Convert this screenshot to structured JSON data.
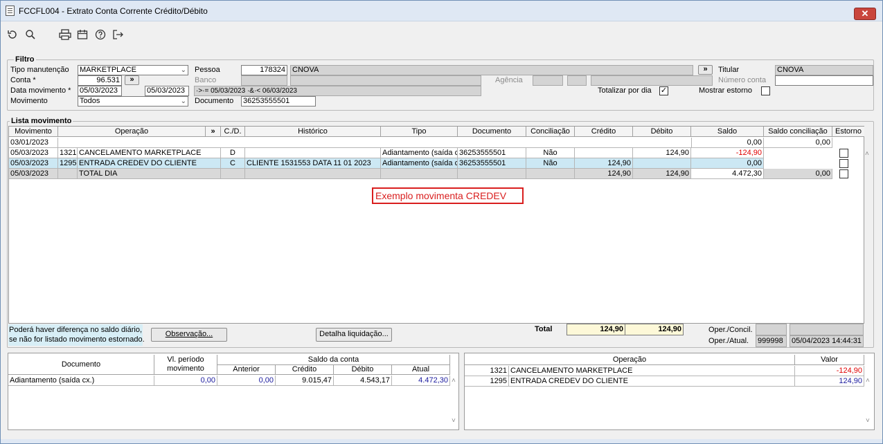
{
  "window": {
    "title": "FCCFL004 - Extrato Conta Corrente Crédito/Débito",
    "close_label": "✕"
  },
  "toolbar": {
    "icons": [
      "refresh-icon",
      "search-icon",
      "print-icon",
      "calendar-icon",
      "help-icon",
      "exit-icon"
    ]
  },
  "filtro": {
    "title": "Filtro",
    "tipo_manutencao_label": "Tipo manutenção",
    "tipo_manutencao_value": "MARKETPLACE",
    "conta_label": "Conta *",
    "conta_value": "96.531",
    "data_movimento_label": "Data movimento *",
    "data_de": "05/03/2023",
    "data_ate": "05/03/2023",
    "data_expr": "·>·= 05/03/2023 ·&·< 06/03/2023",
    "movimento_label": "Movimento",
    "movimento_value": "Todos",
    "pessoa_label": "Pessoa",
    "pessoa_code": "178324",
    "pessoa_name": "CNOVA",
    "banco_label": "Banco",
    "agencia_label": "Agência",
    "documento_label": "Documento",
    "documento_value": "36253555501",
    "titular_label": "Titular",
    "titular_value": "CNOVA",
    "numero_conta_label": "Número conta",
    "totalizar_label": "Totalizar por dia",
    "totalizar_checked": "✓",
    "mostrar_estorno_label": "Mostrar estorno",
    "lookup_label": "»"
  },
  "lista": {
    "title": "Lista movimento",
    "headers": [
      "Movimento",
      "Operação",
      "»",
      "C./D.",
      "Histórico",
      "Tipo",
      "Documento",
      "Conciliação",
      "Crédito",
      "Débito",
      "Saldo",
      "Saldo conciliação",
      "Estorno"
    ],
    "rows": [
      {
        "mov": "03/01/2023",
        "cod": "",
        "op": "",
        "cd": "",
        "hist": "",
        "tipo": "",
        "doc": "",
        "conc": "",
        "cred": "",
        "deb": "",
        "saldo": "0,00",
        "saldo_conc": "0,00"
      },
      {
        "mov": "05/03/2023",
        "cod": "1321",
        "op": "CANCELAMENTO MARKETPLACE",
        "cd": "D",
        "hist": "",
        "tipo": "Adiantamento (saída c",
        "doc": "36253555501",
        "conc": "Não",
        "cred": "",
        "deb": "124,90",
        "saldo": "-124,90",
        "saldo_conc": ""
      },
      {
        "mov": "05/03/2023",
        "cod": "1295",
        "op": "ENTRADA CREDEV DO CLIENTE",
        "cd": "C",
        "hist": "CLIENTE  1531553   DATA  11 01 2023",
        "tipo": "Adiantamento (saída c",
        "doc": "36253555501",
        "conc": "Não",
        "cred": "124,90",
        "deb": "",
        "saldo": "0,00",
        "saldo_conc": ""
      },
      {
        "mov": "05/03/2023",
        "cod": "",
        "op": "TOTAL DIA",
        "cd": "",
        "hist": "",
        "tipo": "",
        "doc": "",
        "conc": "",
        "cred": "124,90",
        "deb": "124,90",
        "saldo": "4.472,30",
        "saldo_conc": "0,00"
      }
    ],
    "annotation": "Exemplo movimenta CREDEV"
  },
  "footer": {
    "note_line1": "Poderá haver diferença no saldo diário,",
    "note_line2": "se não for listado movimento estornado.",
    "observacao_btn": "Observação...",
    "detalha_btn": "Detalha liquidação...",
    "total_label": "Total",
    "total_credito": "124,90",
    "total_debito": "124,90",
    "oper_concil_label": "Oper./Concil.",
    "oper_atual_label": "Oper./Atual.",
    "oper_atual_code": "999998",
    "oper_atual_ts": "05/04/2023 14:44:31"
  },
  "resumo": {
    "headers": {
      "documento": "Documento",
      "vl_periodo_1": "Vl. período",
      "vl_periodo_2": "movimento",
      "saldo_conta": "Saldo da conta",
      "anterior": "Anterior",
      "credito": "Crédito",
      "debito": "Débito",
      "atual": "Atual"
    },
    "row": {
      "documento": "Adiantamento (saída cx.)",
      "vl_periodo": "0,00",
      "anterior": "0,00",
      "credito": "9.015,47",
      "debito": "4.543,17",
      "atual": "4.472,30"
    }
  },
  "operacoes": {
    "headers": {
      "operacao": "Operação",
      "valor": "Valor"
    },
    "rows": [
      {
        "cod": "1321",
        "nome": "CANCELAMENTO MARKETPLACE",
        "valor": "-124,90"
      },
      {
        "cod": "1295",
        "nome": "ENTRADA CREDEV DO CLIENTE",
        "valor": "124,90"
      }
    ]
  }
}
